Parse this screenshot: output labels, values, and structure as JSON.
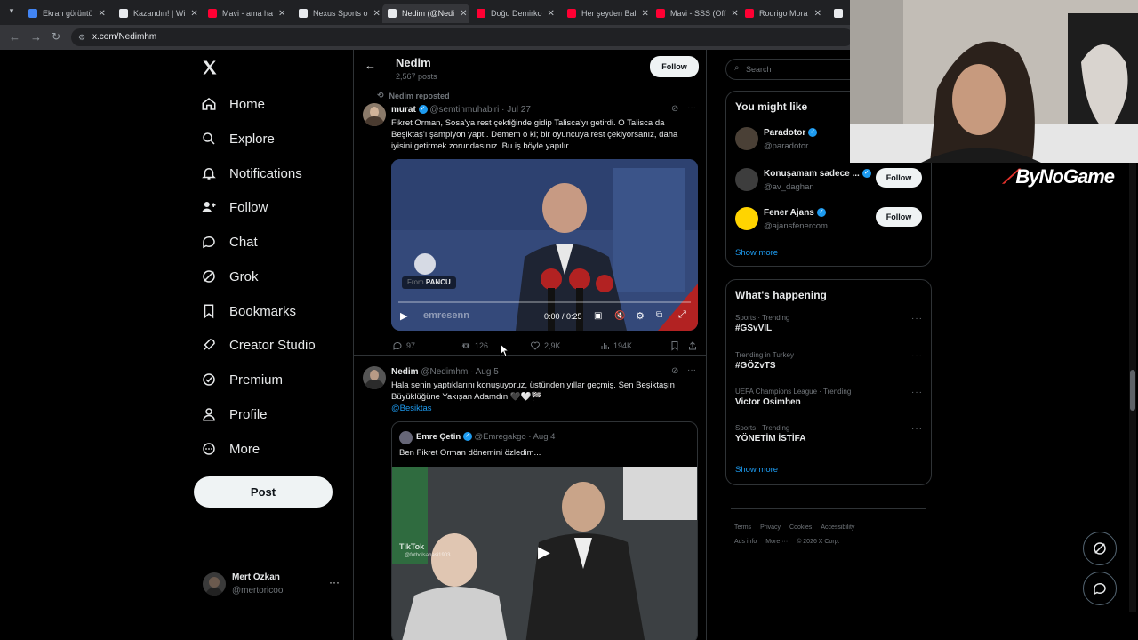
{
  "browser": {
    "tabs": [
      {
        "title": "Ekran görüntü",
        "favicon_color": "#4285f4"
      },
      {
        "title": "Kazandın! | Wi",
        "favicon_color": "#e8eaed"
      },
      {
        "title": "Mavi - ama ha",
        "favicon_color": "#ff0033"
      },
      {
        "title": "Nexus Sports o",
        "favicon_color": "#e8eaed"
      },
      {
        "title": "Nedim (@Nedi",
        "favicon_color": "#e8eaed"
      },
      {
        "title": "Doğu Demirko",
        "favicon_color": "#ff0033"
      },
      {
        "title": "Her şeyden Bal",
        "favicon_color": "#ff0033"
      },
      {
        "title": "Mavi - SSS (Off",
        "favicon_color": "#ff0033"
      },
      {
        "title": "Rodrigo Mora",
        "favicon_color": "#ff0033"
      },
      {
        "title": "N",
        "favicon_color": "#e8eaed"
      }
    ],
    "url": "x.com/Nedimhm"
  },
  "sidebar": {
    "logo": "X",
    "items": [
      {
        "label": "Home",
        "icon": "home-icon"
      },
      {
        "label": "Explore",
        "icon": "search-icon"
      },
      {
        "label": "Notifications",
        "icon": "bell-icon"
      },
      {
        "label": "Follow",
        "icon": "person-plus-icon"
      },
      {
        "label": "Chat",
        "icon": "chat-icon"
      },
      {
        "label": "Grok",
        "icon": "grok-icon"
      },
      {
        "label": "Bookmarks",
        "icon": "bookmark-icon"
      },
      {
        "label": "Creator Studio",
        "icon": "rocket-icon"
      },
      {
        "label": "Premium",
        "icon": "verified-icon"
      },
      {
        "label": "Profile",
        "icon": "person-icon"
      },
      {
        "label": "More",
        "icon": "more-circle-icon"
      }
    ],
    "post_label": "Post",
    "account": {
      "name": "Mert Özkan",
      "handle": "@mertoricoo"
    }
  },
  "header": {
    "name": "Nedim",
    "posts": "2,567 posts",
    "follow_label": "Follow"
  },
  "tweet1": {
    "repost_label": "Nedim reposted",
    "author": "murat",
    "handle": "@semtinmuhabiri",
    "date": "· Jul 27",
    "text": "Fikret Orman, Sosa'ya rest çektiğinde gidip Talisca'yı getirdi. O Talisca da Beşiktaş'ı şampiyon yaptı. Demem o ki; bir oyuncuya rest çekiyorsanız, daha iyisini getirmek zorundasınız. Bu iş böyle yapılır.",
    "video": {
      "from_label": "From",
      "source": "PANCU",
      "time": "0:00 / 0:25",
      "watermark": "emresenn"
    },
    "replies": "97",
    "reposts": "126",
    "likes": "2,9K",
    "views": "194K"
  },
  "tweet2": {
    "author": "Nedim",
    "handle": "@Nedimhm",
    "date": "· Aug 5",
    "text": "Hala senin yaptıklarını konuşuyoruz, üstünden yıllar geçmiş. Sen Beşiktaşın Büyüklüğüne Yakışan Adamdın 🖤🤍🏁",
    "mention": "@Besiktas",
    "quote": {
      "author": "Emre Çetin",
      "handle": "@Emregakgo",
      "date": "· Aug 4",
      "text": "Ben Fikret Orman dönemini özledim...",
      "watermark": "TikTok",
      "watermark_handle": "@futbolsahasi1903"
    }
  },
  "search": {
    "placeholder": "Search"
  },
  "might_like": {
    "title": "You might like",
    "users": [
      {
        "name": "Paradotor",
        "handle": "@paradotor",
        "verified": true,
        "follow_label": ""
      },
      {
        "name": "Konuşamam sadece ...",
        "handle": "@av_daghan",
        "verified": true,
        "follow_label": "Follow"
      },
      {
        "name": "Fener Ajans",
        "handle": "@ajansfenercom",
        "verified": true,
        "follow_label": "Follow"
      }
    ],
    "show_more": "Show more"
  },
  "happening": {
    "title": "What's happening",
    "trends": [
      {
        "meta": "Sports · Trending",
        "name": "#GSvVIL"
      },
      {
        "meta": "Trending in Turkey",
        "name": "#GÖZvTS"
      },
      {
        "meta": "UEFA Champions League · Trending",
        "name": "Victor Osimhen"
      },
      {
        "meta": "Sports · Trending",
        "name": "YÖNETİM İSTİFA"
      }
    ],
    "show_more": "Show more"
  },
  "footer": {
    "links": [
      "Terms",
      "Privacy",
      "Cookies",
      "Accessibility",
      "Ads info",
      "More ···",
      "© 2026 X Corp."
    ]
  },
  "overlay": {
    "brand": "ByNoGame"
  },
  "colors": {
    "accent": "#1d9bf0",
    "background": "#000000",
    "border": "#2f3336"
  }
}
